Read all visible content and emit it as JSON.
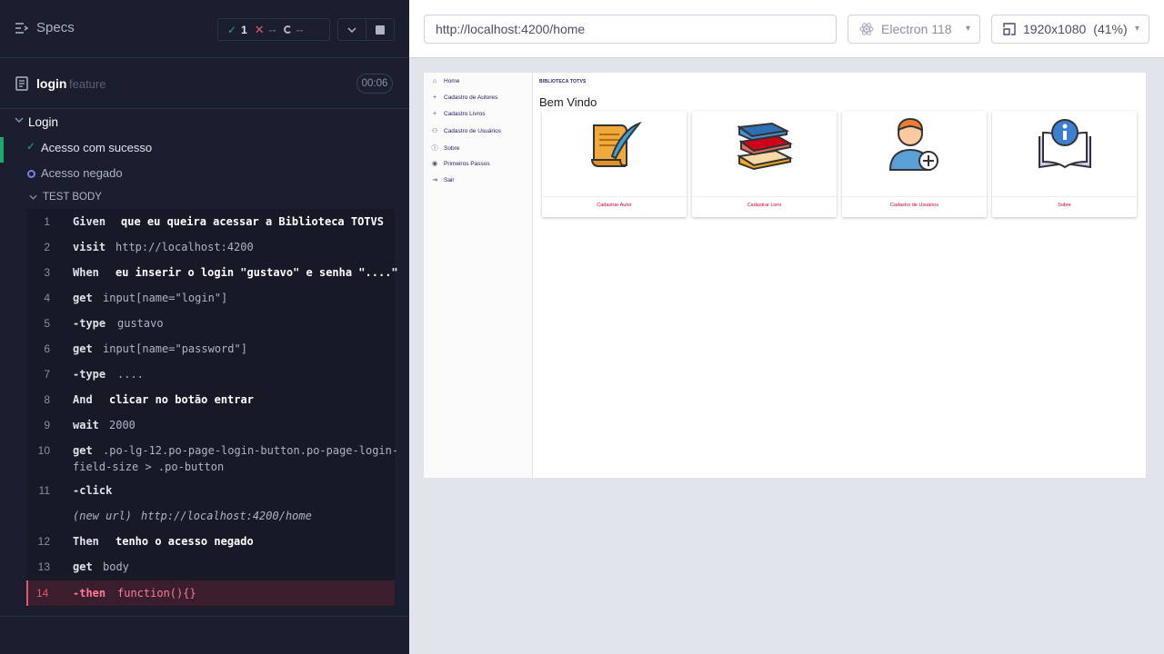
{
  "runner": {
    "specs_label": "Specs",
    "stats": {
      "passed": "1",
      "failed": "--",
      "pending": "--"
    },
    "file": {
      "name": "login",
      "ext": "feature",
      "duration": "00:06"
    },
    "suite": "Login",
    "tests": [
      {
        "title": "Acesso com sucesso",
        "state": "passed"
      },
      {
        "title": "Acesso negado",
        "state": "running"
      }
    ],
    "test_body_label": "TEST BODY",
    "commands": [
      {
        "num": "1",
        "name": "Given",
        "message": "que eu queira acessar a Biblioteca TOTVS",
        "bold": true
      },
      {
        "num": "2",
        "name": "visit",
        "message": "http://localhost:4200"
      },
      {
        "num": "3",
        "name": "When",
        "message": "eu inserir o login \"gustavo\" e senha \"....\"",
        "bold": true
      },
      {
        "num": "4",
        "name": "get",
        "message": "input[name=\"login\"]"
      },
      {
        "num": "5",
        "name": "-type",
        "message": "gustavo"
      },
      {
        "num": "6",
        "name": "get",
        "message": "input[name=\"password\"]"
      },
      {
        "num": "7",
        "name": "-type",
        "message": "...."
      },
      {
        "num": "8",
        "name": "And",
        "message": "clicar no botão entrar",
        "bold": true
      },
      {
        "num": "9",
        "name": "wait",
        "message": "2000"
      },
      {
        "num": "10",
        "name": "get",
        "message": ".po-lg-12.po-page-login-button.po-page-login-",
        "message2": "field-size > .po-button"
      },
      {
        "num": "11",
        "name": "-click",
        "message": ""
      },
      {
        "num": "",
        "name": "(new url)",
        "message": "http://localhost:4200/home",
        "italic": true
      },
      {
        "num": "12",
        "name": "Then",
        "message": "tenho o acesso negado",
        "bold": true
      },
      {
        "num": "13",
        "name": "get",
        "message": "body"
      },
      {
        "num": "14",
        "name": "-then",
        "message": "function(){}",
        "error": true
      }
    ]
  },
  "preview": {
    "url": "http://localhost:4200/home",
    "browser": "Electron 118",
    "viewport": "1920x1080",
    "scale": "(41%)"
  },
  "app": {
    "menu": [
      {
        "label": "Home",
        "icon": "home-icon"
      },
      {
        "label": "Cadastro de Autores",
        "icon": "plus-icon"
      },
      {
        "label": "Cadastro Livros",
        "icon": "plus-icon"
      },
      {
        "label": "Cadastro de Usuários",
        "icon": "user-icon"
      },
      {
        "label": "Sobre",
        "icon": "info-icon"
      },
      {
        "label": "Primeiros Passos",
        "icon": "eye-icon"
      },
      {
        "label": "Sair",
        "icon": "exit-icon"
      }
    ],
    "brand": "BIBLIOTECA TOTVS",
    "welcome": "Bem Vindo",
    "cards": [
      {
        "label": "Cadastrar Autor",
        "icon": "scroll-quill-icon"
      },
      {
        "label": "Cadastrar Livro",
        "icon": "books-icon"
      },
      {
        "label": "Cadastro de Usuários",
        "icon": "add-user-icon"
      },
      {
        "label": "Sobre",
        "icon": "info-book-icon"
      }
    ]
  },
  "colors": {
    "pass": "#1fa971",
    "fail": "#e45770",
    "accent": "#c9003c",
    "brand": "#291b5c"
  }
}
